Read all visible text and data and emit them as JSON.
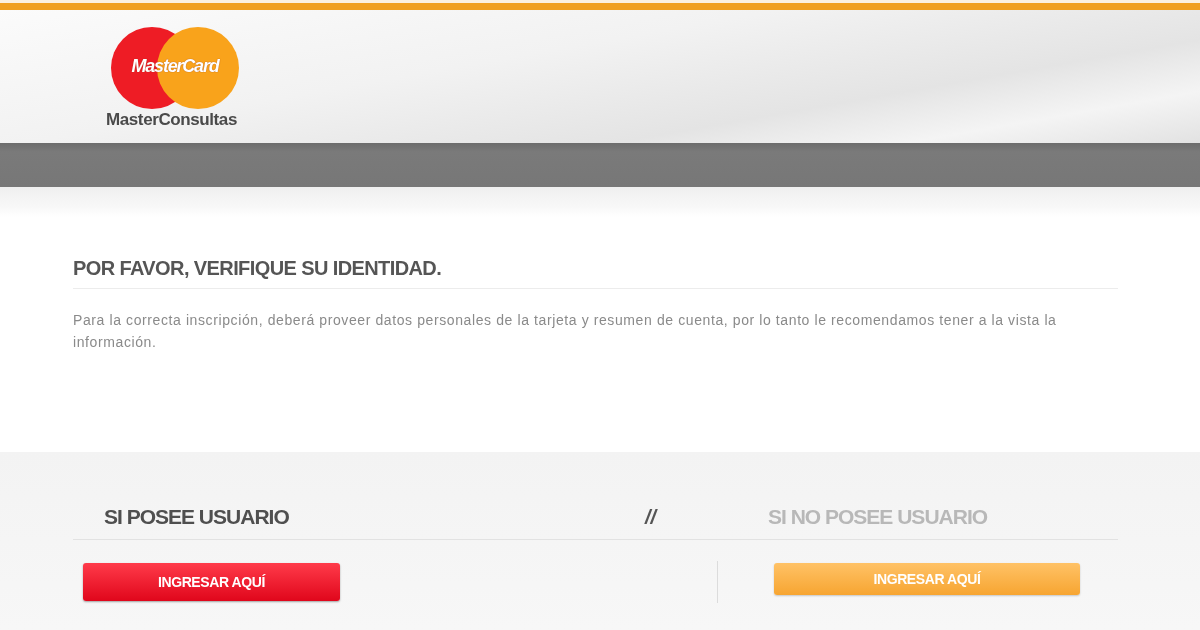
{
  "header": {
    "logo": {
      "brand": "MasterCard",
      "caption": "MasterConsultas"
    }
  },
  "verification": {
    "title": "POR FAVOR, VERIFIQUE SU IDENTIDAD.",
    "text": "Para la correcta inscripción, deberá proveer datos personales de la tarjeta y resumen de cuenta, por lo tanto le recomendamos tener a la vista la información."
  },
  "separator": "//",
  "options": [
    {
      "kind": "primary",
      "heading": "SI POSEE USUARIO",
      "button": "INGRESAR AQUÍ"
    },
    {
      "kind": "secondary",
      "heading": "SI NO POSEE USUARIO",
      "button": "INGRESAR AQUÍ"
    }
  ]
}
